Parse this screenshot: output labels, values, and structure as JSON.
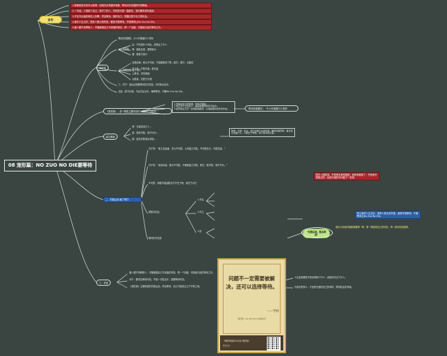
{
  "root": {
    "title": "08 宠形篇：NO ZUO NO DIE要等待"
  },
  "quotes": {
    "label": "金句",
    "items": [
      "1.即使是成功本可以取得，但我们必须做好准备，等待对手犯错的时刻降临。",
      "2.一句话，人想成了自己，想不了别人，失败的可能一直都在，我们都有权利选择。",
      "3.不在不合适的事情上折腾，学会等待，做好自己，把握住属于自己的机会。",
      "4.我们人生当中，很多人很大的失败，都是不能等待，不能等待让No Zuo No Die。",
      "5.做人要不折腾别人，不随便做自己不该做的事情，再一个没做，可能就已经在等待之中。"
    ]
  },
  "ideas": {
    "label": "关键词",
    "items": [
      "等待的重要性：什么时候做什么事情",
      "一、先别乱",
      "乱：不知道什么叫乱，到底乱了什么",
      "等：随机应变，顺势而为",
      "慢：要量力而行",
      "二、先胜后战-赢了再打",
      "自强自律，耐心不可测，不能随便说了算，能打，能守，也能忍",
      "先立先：不败在我，胜在敌",
      "上策也，切勿焦躁",
      "大胜者，先胜于乐观",
      "三、同于：最后还是要等待形式改变，切勿盲目出击",
      "总结：胜乎乐观、不乱先乱对手，懂得等待，不要No Zuo No Die。"
    ]
  },
  "questions": {
    "label": "《宠形篇》，讲一般性主要内容可以归为三个层次：",
    "items": [
      "1.管得住自己的情绪，管得不焦躁；",
      "2.真正善于打仗的人，都是能做到稳而不乱的；",
      "3.如何保证万无一失地取得胜利，以得胜者的身份去作战。"
    ],
    "note": "\"等待的重要性\"，\"什么时候做什么事情\""
  },
  "original": {
    "label": "原文解读",
    "items": [
      "昔：古者善战之人…",
      "胜：胜利可知，而不可为…",
      "胜：胜兵先胜而后求战…"
    ],
    "note": "简单、冷静、专注，自己在做什么的时候，要搞清楚形势，看清自己在做什么，不能急于求成，也不能冲动行事。"
  },
  "part2": {
    "label": "二、先胜后战-赢了再打",
    "items": [
      "孙子说：\"昔之善战者，先为不可胜，以待敌之可胜。不可胜在己，可胜在敌。\"",
      "孙子说：\"善用兵者，能为不可胜，不能使敌之可胜。故曰：胜可知，而不可为。\"",
      "不可胜：我能不能战胜对方不在于我，而在于对方",
      "1.不乱",
      "2.先立",
      "3.形",
      "把握住机会",
      "等待形式改变"
    ],
    "red_note": "很多人做错事，不是他本身想做错，而是他做错了，不是我们想要这样，而是在错的时间做了一些事。",
    "blue_note": "所以我们人生当中，很多人很大的失败，都是不能等待，不能等待让No Zuo No Die。",
    "green_label": "\"先胜后战，胜后再战\"",
    "right_note": "我们大多数时候都需要等一等，等一等看看自己的状态，再一看事情的趋势。"
  },
  "summary": {
    "label": "三、总结",
    "items": [
      "做人要不折腾别人，不随便做自己不该做的事情，再一个没做，可能就已经在等待之中。",
      "对于：要学会等待时机，不能一次性出手，需要等待时机。",
      "《宠形篇》主要阐述的先胜后战，学会等待，自己才能真正立于不败之地。"
    ],
    "notes": [
      "人生最重要的不是你得到了什么，而是你付出了什么。",
      "与其羡慕别人，不如低头做好自己的事情，等待机会的来临。"
    ]
  },
  "book": {
    "quote_line1": "问题不一定需要被解",
    "quote_line2": "决，还可以选择等待。",
    "signature": "——学杉",
    "source": "《樊登说：NO ZUO NO DIE要等待》",
    "footer": "《樊登讲透孙子兵法·宠形篇》",
    "footer_sub": "樊登读书"
  },
  "colors": {
    "background": "#3a4542",
    "line": "#d8e2dc",
    "red_box": "#a7262b",
    "blue_box": "#2b5fa6",
    "yellow_pill": "#f1e06d",
    "green_pill": "#bfe58a"
  }
}
